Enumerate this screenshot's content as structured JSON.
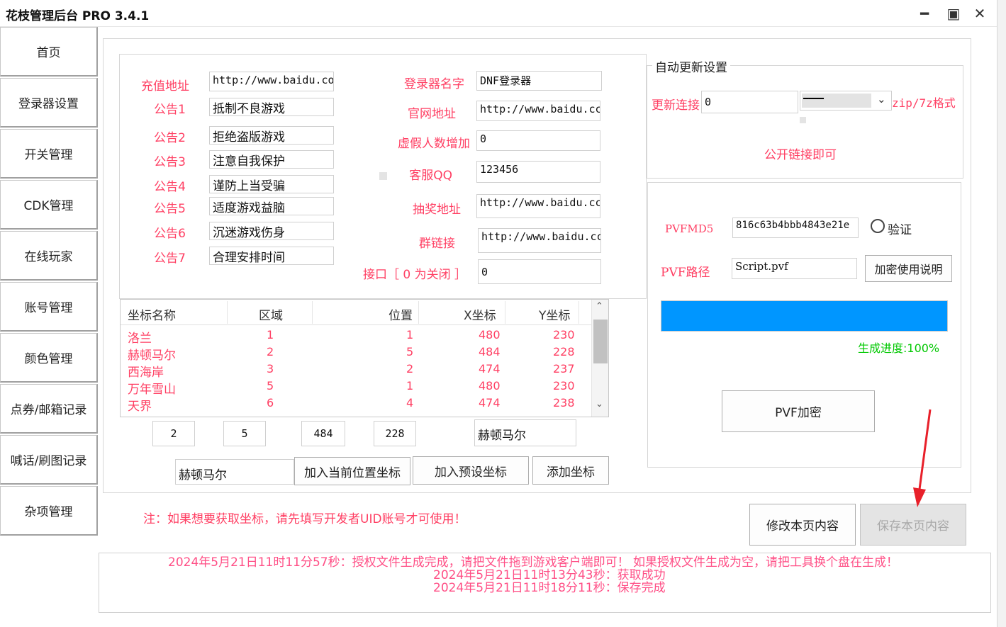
{
  "window": {
    "title": "花枝管理后台 PRO 3.4.1",
    "minimize": "━",
    "maximize": "▣",
    "close": "✕"
  },
  "sidebar": [
    "首页",
    "登录器设置",
    "开关管理",
    "CDK管理",
    "在线玩家",
    "账号管理",
    "颜色管理",
    "点券/邮箱记录",
    "喊话/刷图记录",
    "杂项管理"
  ],
  "left_form": {
    "recharge_label": "充值地址",
    "recharge_value": "http://www.baidu.co",
    "notices": [
      {
        "label": "公告1",
        "value": "抵制不良游戏"
      },
      {
        "label": "公告2",
        "value": "拒绝盗版游戏"
      },
      {
        "label": "公告3",
        "value": "注意自我保护"
      },
      {
        "label": "公告4",
        "value": "谨防上当受骗"
      },
      {
        "label": "公告5",
        "value": "适度游戏益脑"
      },
      {
        "label": "公告6",
        "value": "沉迷游戏伤身"
      },
      {
        "label": "公告7",
        "value": "合理安排时间"
      }
    ]
  },
  "mid_form": {
    "launcher_name_label": "登录器名字",
    "launcher_name_value": "DNF登录器",
    "site_label": "官网地址",
    "site_value": "http://www.baidu.cc",
    "fake_label": "虚假人数增加",
    "fake_value": "0",
    "qq_label": "客服QQ",
    "qq_value": "123456",
    "lottery_label": "抽奖地址",
    "lottery_value": "http://www.baidu.cc",
    "group_label": "群链接",
    "group_value": "http://www.baidu.cc",
    "port_label": "接口［ 0 为关闭 ］",
    "port_value": "0"
  },
  "auto_update": {
    "title": "自动更新设置",
    "link_label": "更新连接",
    "link_value": "0",
    "format_selected": "━━━━",
    "format_hint": "zip/7z格式",
    "public_link_hint": "公开链接即可"
  },
  "pvf": {
    "md5_label": "PVFMD5",
    "md5_value": "816c63b4bbb4843e21e",
    "verify_label": "验证",
    "path_label": "PVF路径",
    "path_value": "Script.pvf",
    "help_button": "加密使用说明",
    "progress_text": "生成进度:100%",
    "progress_fraction": 1.0,
    "progress_color": "#0096ff",
    "encrypt_button": "PVF加密"
  },
  "coords_table": {
    "headers": [
      "坐标名称",
      "区域",
      "位置",
      "X坐标",
      "Y坐标"
    ],
    "rows": [
      [
        "洛兰",
        "1",
        "1",
        "480",
        "230"
      ],
      [
        "赫顿马尔",
        "2",
        "5",
        "484",
        "228"
      ],
      [
        "西海岸",
        "3",
        "2",
        "474",
        "237"
      ],
      [
        "万年雪山",
        "5",
        "1",
        "480",
        "230"
      ],
      [
        "天界",
        "6",
        "4",
        "474",
        "238"
      ]
    ]
  },
  "coord_edit": {
    "area": "2",
    "pos": "5",
    "x": "484",
    "y": "228",
    "name_right": "赫顿马尔",
    "name_input": "赫顿马尔",
    "add_current_button": "加入当前位置坐标",
    "add_preset_button": "加入预设坐标",
    "add_button": "添加坐标"
  },
  "note": "注：如果想要获取坐标，请先填写开发者UID账号才可使用！",
  "footer_buttons": {
    "modify": "修改本页内容",
    "save": "保存本页内容"
  },
  "log": [
    "2024年5月21日11时11分57秒：授权文件生成完成，请把文件拖到游戏客户端即可！ 如果授权文件生成为空，请把工具换个盘在生成！",
    "2024年5月21日11时13分43秒：获取成功",
    "2024年5月21日11时18分11秒：保存完成"
  ],
  "colors": {
    "label_red": "#ff3f63",
    "progress_green": "#00c800",
    "progress_bar": "#0096ff",
    "annotation_arrow": "#e8202a"
  }
}
